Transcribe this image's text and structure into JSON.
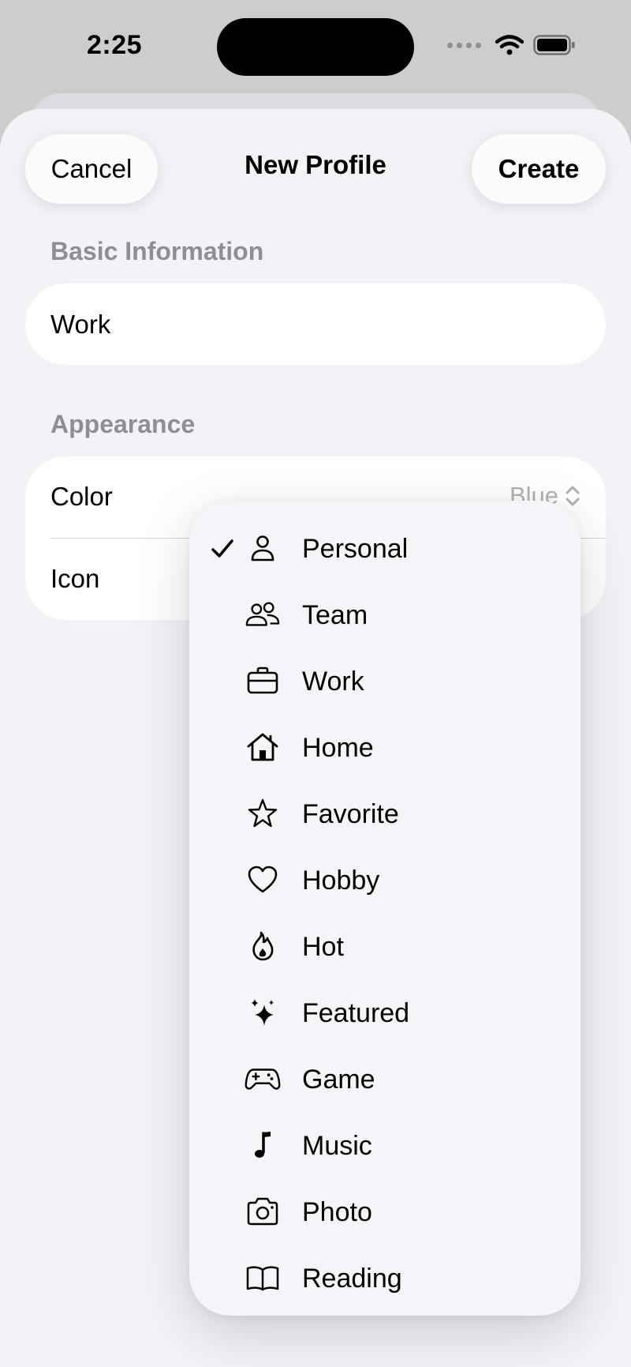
{
  "status_bar": {
    "time": "2:25"
  },
  "header": {
    "title": "New Profile",
    "cancel_label": "Cancel",
    "create_label": "Create"
  },
  "basic_info": {
    "section_title": "Basic Information",
    "name_value": "Work"
  },
  "appearance": {
    "section_title": "Appearance",
    "color_label": "Color",
    "color_value": "Blue",
    "icon_label": "Icon"
  },
  "icon_menu": {
    "selected": "Personal",
    "items": [
      {
        "label": "Personal",
        "icon": "person-icon",
        "checked": true
      },
      {
        "label": "Team",
        "icon": "people-icon",
        "checked": false
      },
      {
        "label": "Work",
        "icon": "briefcase-icon",
        "checked": false
      },
      {
        "label": "Home",
        "icon": "house-icon",
        "checked": false
      },
      {
        "label": "Favorite",
        "icon": "star-icon",
        "checked": false
      },
      {
        "label": "Hobby",
        "icon": "heart-icon",
        "checked": false
      },
      {
        "label": "Hot",
        "icon": "flame-icon",
        "checked": false
      },
      {
        "label": "Featured",
        "icon": "sparkles-icon",
        "checked": false
      },
      {
        "label": "Game",
        "icon": "gamecontroller-icon",
        "checked": false
      },
      {
        "label": "Music",
        "icon": "music-note-icon",
        "checked": false
      },
      {
        "label": "Photo",
        "icon": "camera-icon",
        "checked": false
      },
      {
        "label": "Reading",
        "icon": "book-icon",
        "checked": false
      }
    ]
  }
}
